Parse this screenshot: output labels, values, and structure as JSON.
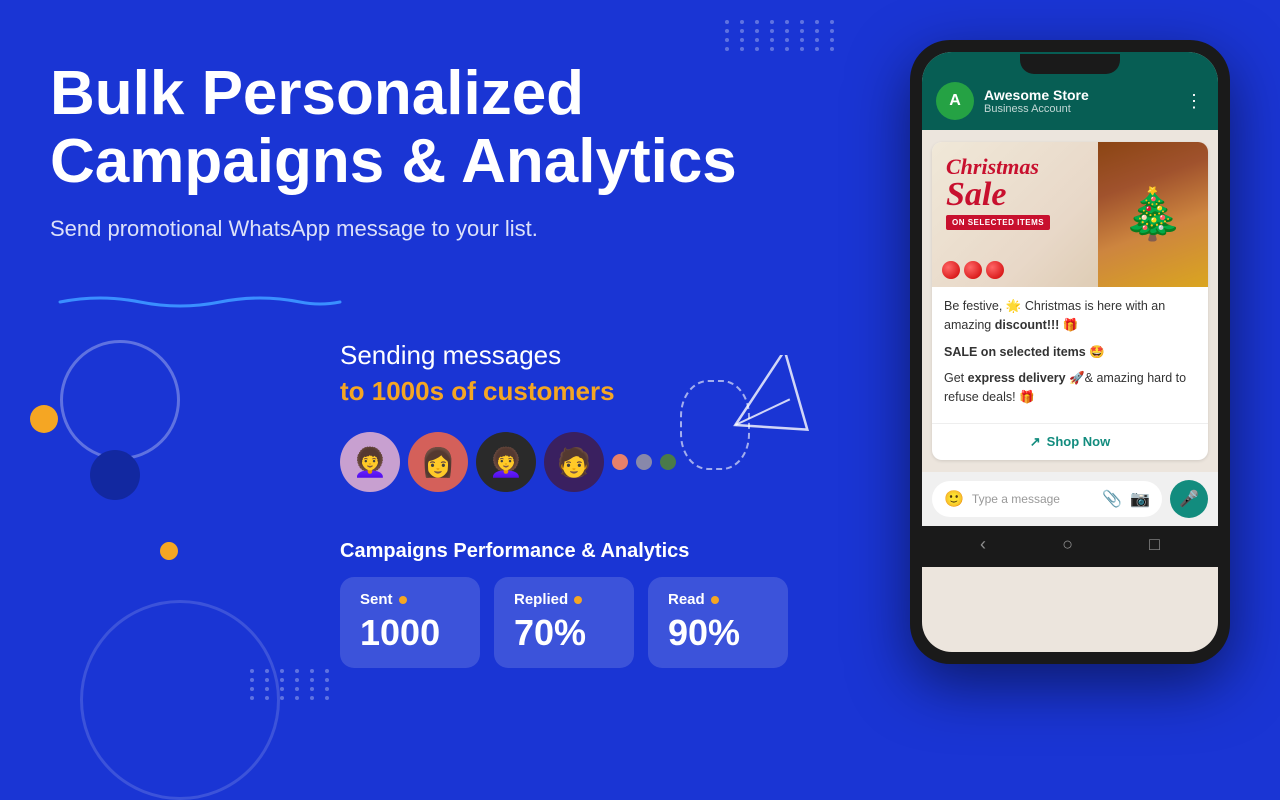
{
  "background": {
    "color": "#1a35d4"
  },
  "hero": {
    "heading_line1": "Bulk Personalized",
    "heading_line2": "Campaigns & Analytics",
    "subheading": "Send promotional WhatsApp message to your list."
  },
  "sending": {
    "line1": "Sending messages",
    "line2": "to 1000s of customers"
  },
  "avatars": [
    {
      "emoji": "👩‍🦱",
      "bg": "#c8a0d0"
    },
    {
      "emoji": "👩",
      "bg": "#d4605a"
    },
    {
      "emoji": "👩‍🦱",
      "bg": "#2a2a2a"
    },
    {
      "emoji": "🧑",
      "bg": "#3a2060"
    }
  ],
  "performance": {
    "title": "Campaigns Performance & Analytics",
    "stats": [
      {
        "label": "Sent",
        "value": "1000"
      },
      {
        "label": "Replied",
        "value": "70%"
      },
      {
        "label": "Read",
        "value": "90%"
      }
    ]
  },
  "phone": {
    "contact_name": "Awesome Store",
    "contact_status": "Business Account",
    "contact_initial": "A",
    "message_image_alt": "Christmas Sale on selected items",
    "xmas_line1": "Christmas",
    "xmas_line2": "Sale",
    "xmas_selected": "ON SELECTED ITEMS",
    "message_body_1": "Be festive, 🌟 Christmas is here with an amazing",
    "message_bold_1": "discount!!!",
    "message_emoji_1": "🎁",
    "message_sale_label": "SALE on selected items 🤩",
    "message_body_2": "Get",
    "message_bold_2": "express delivery",
    "message_body_3": "🚀& amazing hard to refuse deals! 🎁",
    "shop_now_label": "Shop Now",
    "input_placeholder": "Type a message"
  }
}
